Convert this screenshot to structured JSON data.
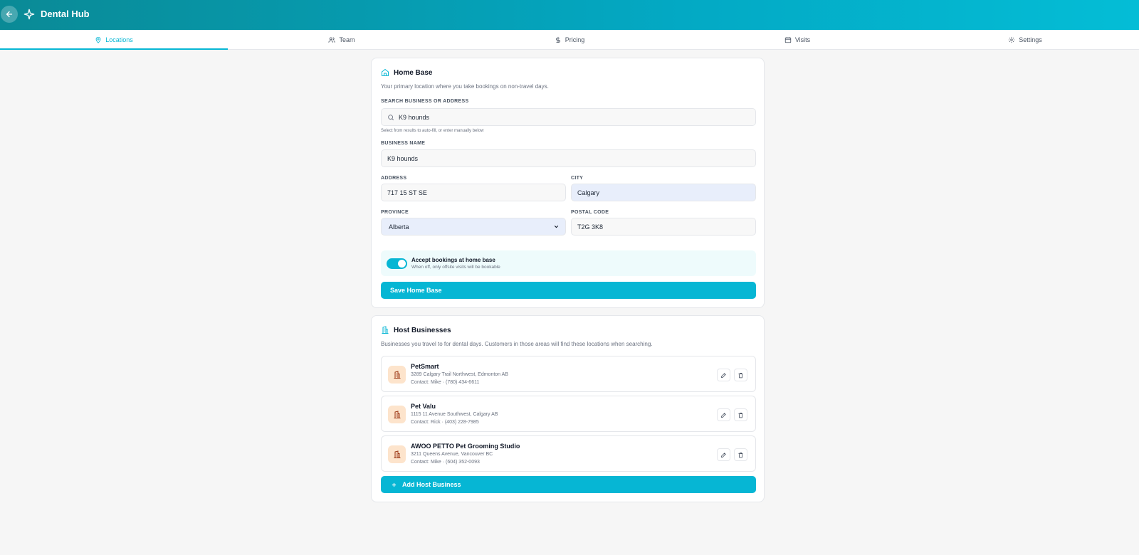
{
  "header": {
    "title": "Dental Hub"
  },
  "tabs": [
    {
      "label": "Locations",
      "icon": "map-pin-icon",
      "active": true
    },
    {
      "label": "Team",
      "icon": "users-icon"
    },
    {
      "label": "Pricing",
      "icon": "dollar-icon"
    },
    {
      "label": "Visits",
      "icon": "calendar-icon"
    },
    {
      "label": "Settings",
      "icon": "gear-icon"
    }
  ],
  "home_base": {
    "title": "Home Base",
    "description": "Your primary location where you take bookings on non-travel days.",
    "search_label": "SEARCH BUSINESS OR ADDRESS",
    "search_value": "K9 hounds",
    "search_help": "Select from results to auto-fill, or enter manually below",
    "business_name_label": "BUSINESS NAME",
    "business_name_value": "K9 hounds",
    "address_label": "ADDRESS",
    "address_value": "717 15 ST SE",
    "city_label": "CITY",
    "city_value": "Calgary",
    "province_label": "PROVINCE",
    "province_value": "Alberta",
    "postal_label": "POSTAL CODE",
    "postal_value": "T2G 3K8",
    "toggle_title": "Accept bookings at home base",
    "toggle_sub": "When off, only offsite visits will be bookable",
    "toggle_on": true,
    "save_label": "Save Home Base"
  },
  "host_businesses": {
    "title": "Host Businesses",
    "description": "Businesses you travel to for dental days. Customers in those areas will find these locations when searching.",
    "items": [
      {
        "name": "PetSmart",
        "address": "3289 Calgary Trail Northwest, Edmonton AB",
        "contact": "Contact: Mike · (780) 434-6611"
      },
      {
        "name": "Pet Valu",
        "address": "1115 11 Avenue Southwest, Calgary AB",
        "contact": "Contact: Rick · (403) 228-7985"
      },
      {
        "name": "AWOO PETTO Pet Grooming Studio",
        "address": "3211 Queens Avenue, Vancouver BC",
        "contact": "Contact: Mike · (604) 352-0093"
      }
    ],
    "add_label": "Add Host Business"
  },
  "colors": {
    "accent": "#06b6d4",
    "header_start": "#0a8a96",
    "header_end": "#04bdd6",
    "host_icon_bg": "#fde4cc"
  }
}
